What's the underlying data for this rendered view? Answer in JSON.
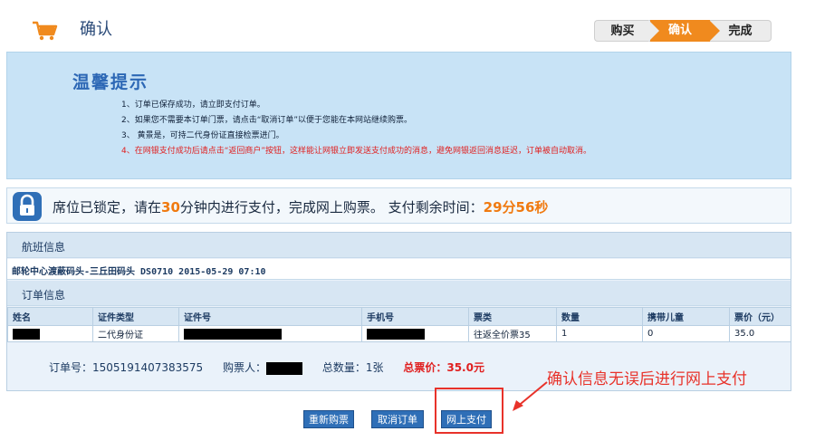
{
  "header": {
    "title": "确认",
    "steps": [
      "购买",
      "确认",
      "完成"
    ]
  },
  "notice": {
    "title": "温馨提示",
    "lines": [
      "1、订单已保存成功，请立即支付订单。",
      "2、如果您不需要本订单门票，请点击“取消订单”以便于您能在本网站继续购票。",
      "3、 黄景是，可持二代身份证直接检票进门。",
      "4、在网银支付成功后请点击“返回商户”按钮，这样能让网银立即发送支付成功的消息，避免网银返回消息延迟，订单被自动取消。"
    ]
  },
  "lock": {
    "text_before": "席位已锁定，请在",
    "minutes": "30",
    "text_after": "分钟内进行支付，完成网上购票。 支付剩余时间：",
    "remaining": "29分56秒"
  },
  "flight": {
    "heading": "航班信息",
    "line": "邮轮中心渡蔽码头-三丘田码头 DS0710 2015-05-29 07:10"
  },
  "order": {
    "heading": "订单信息",
    "columns": [
      "姓名",
      "证件类型",
      "证件号",
      "手机号",
      "票类",
      "数量",
      "携带儿童",
      "票价（元）"
    ],
    "row": [
      "",
      "二代身份证",
      "",
      "",
      "往返全价票35",
      "1",
      "0",
      "35.0"
    ],
    "order_no_label": "订单号：",
    "order_no": "1505191407383575",
    "buyer_label": "购票人：",
    "qty_label": "总数量：",
    "qty": "1张",
    "total_label": "总票价：",
    "total": "35.0元"
  },
  "callout": "确认信息无误后进行网上支付",
  "buttons": {
    "rebuy": "重新购票",
    "cancel": "取消订单",
    "pay": "网上支付"
  },
  "colors": {
    "accent": "#f08a1e",
    "notice_bg": "#c8e3f6",
    "button": "#2f6fb7",
    "alert": "#e8322a"
  }
}
